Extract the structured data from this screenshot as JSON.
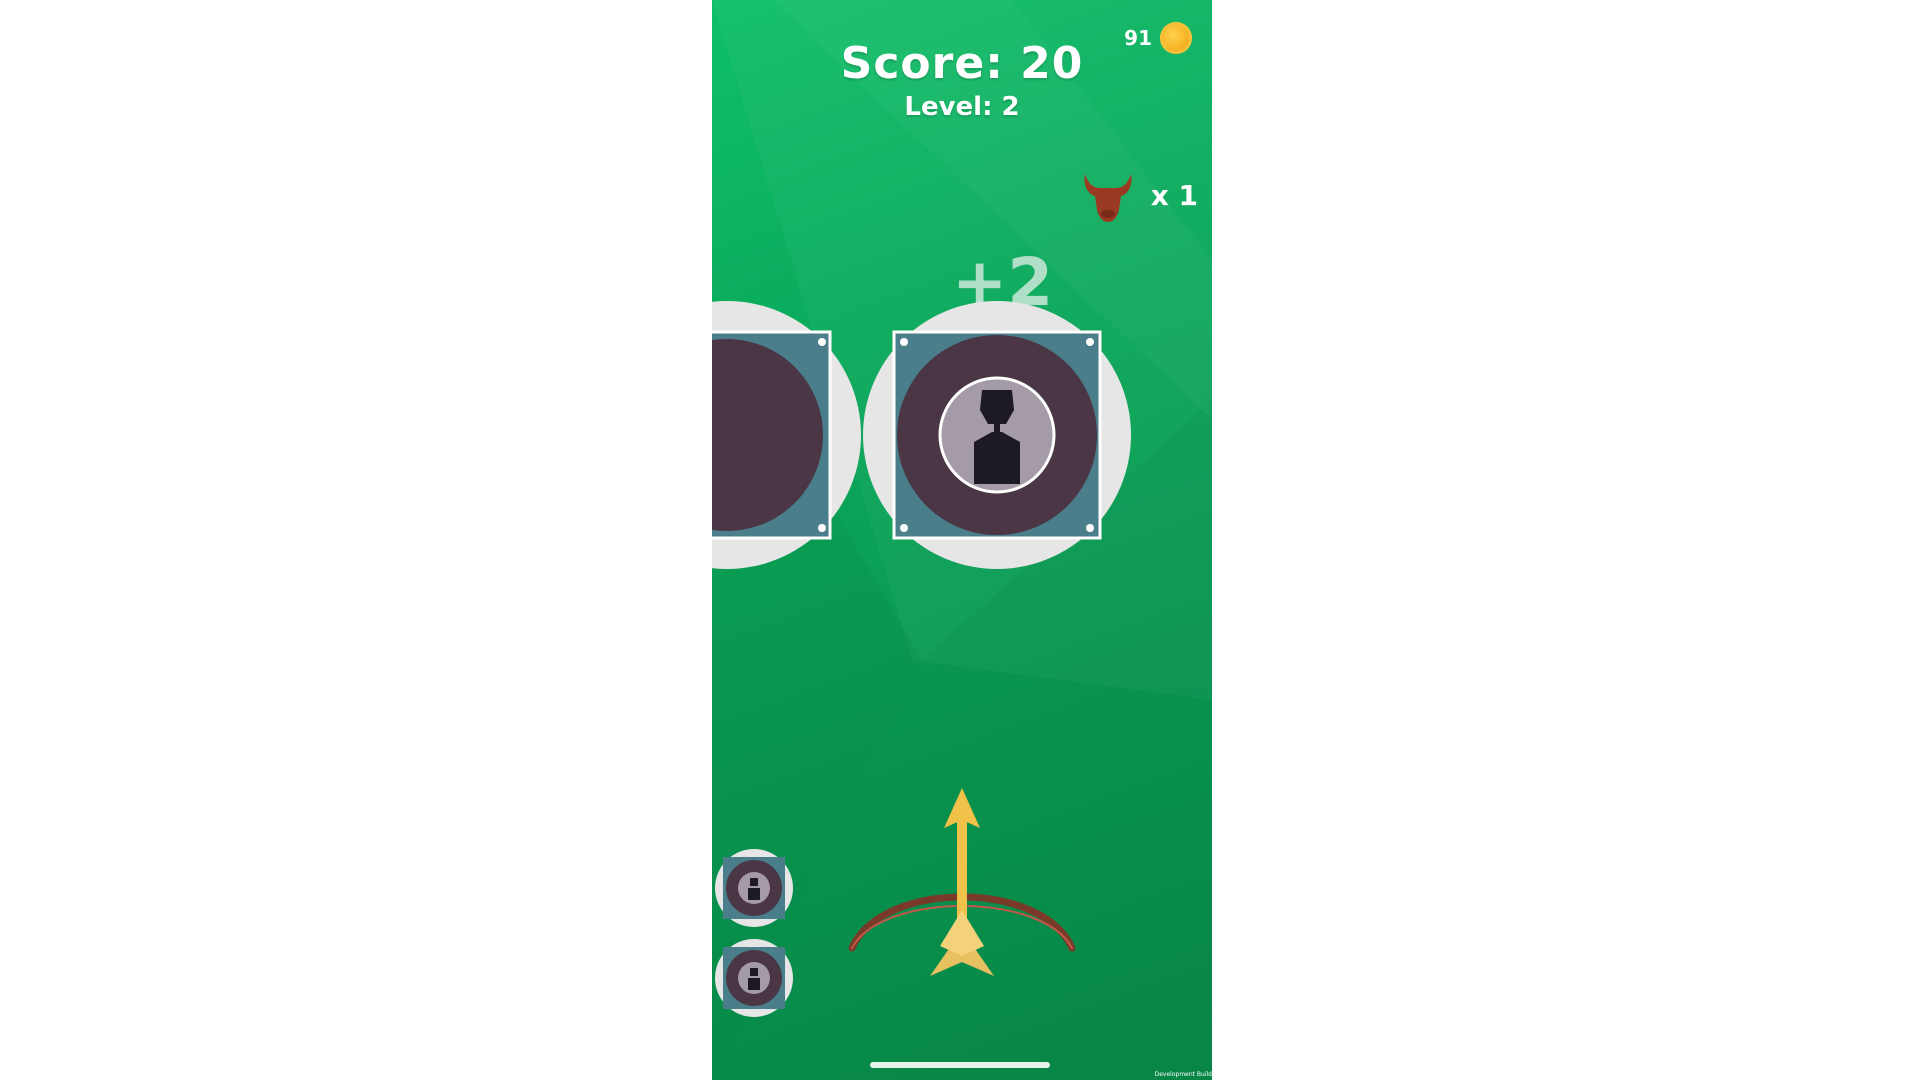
{
  "hud": {
    "score_text": "Score: 20",
    "level_text": "Level: 2",
    "coins": "91",
    "bull_multiplier": "x 1"
  },
  "popup": {
    "bonus_text": "+2"
  },
  "footer": {
    "build_label": "Development Build"
  },
  "icons": {
    "coin": "coin-icon",
    "bull": "bull-head-icon",
    "bow": "bow-and-arrow-icon",
    "target": "silhouette-target-icon"
  },
  "colors": {
    "background_top": "#0fbf68",
    "background_bottom": "#088a48",
    "target_plate": "#4a7e8a",
    "target_ring": "#4a3645",
    "target_center": "#a49aa8",
    "silhouette": "#1e1a24",
    "bow_wood": "#7a3a2a",
    "arrow": "#f0c24a",
    "coin": "#f5b021",
    "bull": "#9b3a22"
  },
  "remaining_targets": 2
}
